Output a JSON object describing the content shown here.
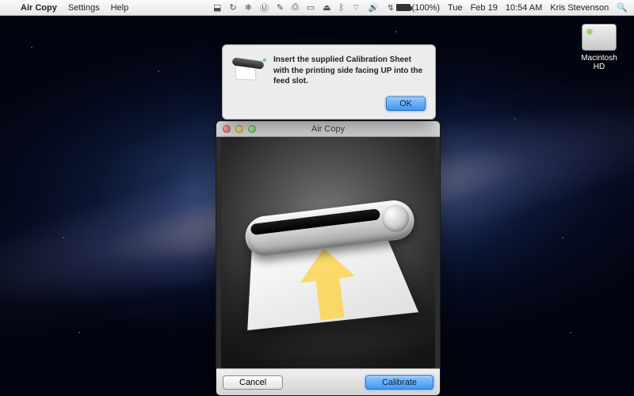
{
  "menubar": {
    "app_name": "Air Copy",
    "items": [
      "Settings",
      "Help"
    ],
    "battery_pct": "(100%)",
    "day": "Tue",
    "date": "Feb 19",
    "time": "10:54 AM",
    "user": "Kris Stevenson"
  },
  "desktop": {
    "hd_label": "Macintosh HD"
  },
  "alert": {
    "message": "Insert the supplied Calibration Sheet with the printing side facing UP into the feed slot.",
    "ok_label": "OK"
  },
  "aircopy": {
    "title": "Air Copy",
    "cancel_label": "Cancel",
    "calibrate_label": "Calibrate"
  },
  "colors": {
    "accent": "#3f97f0"
  }
}
